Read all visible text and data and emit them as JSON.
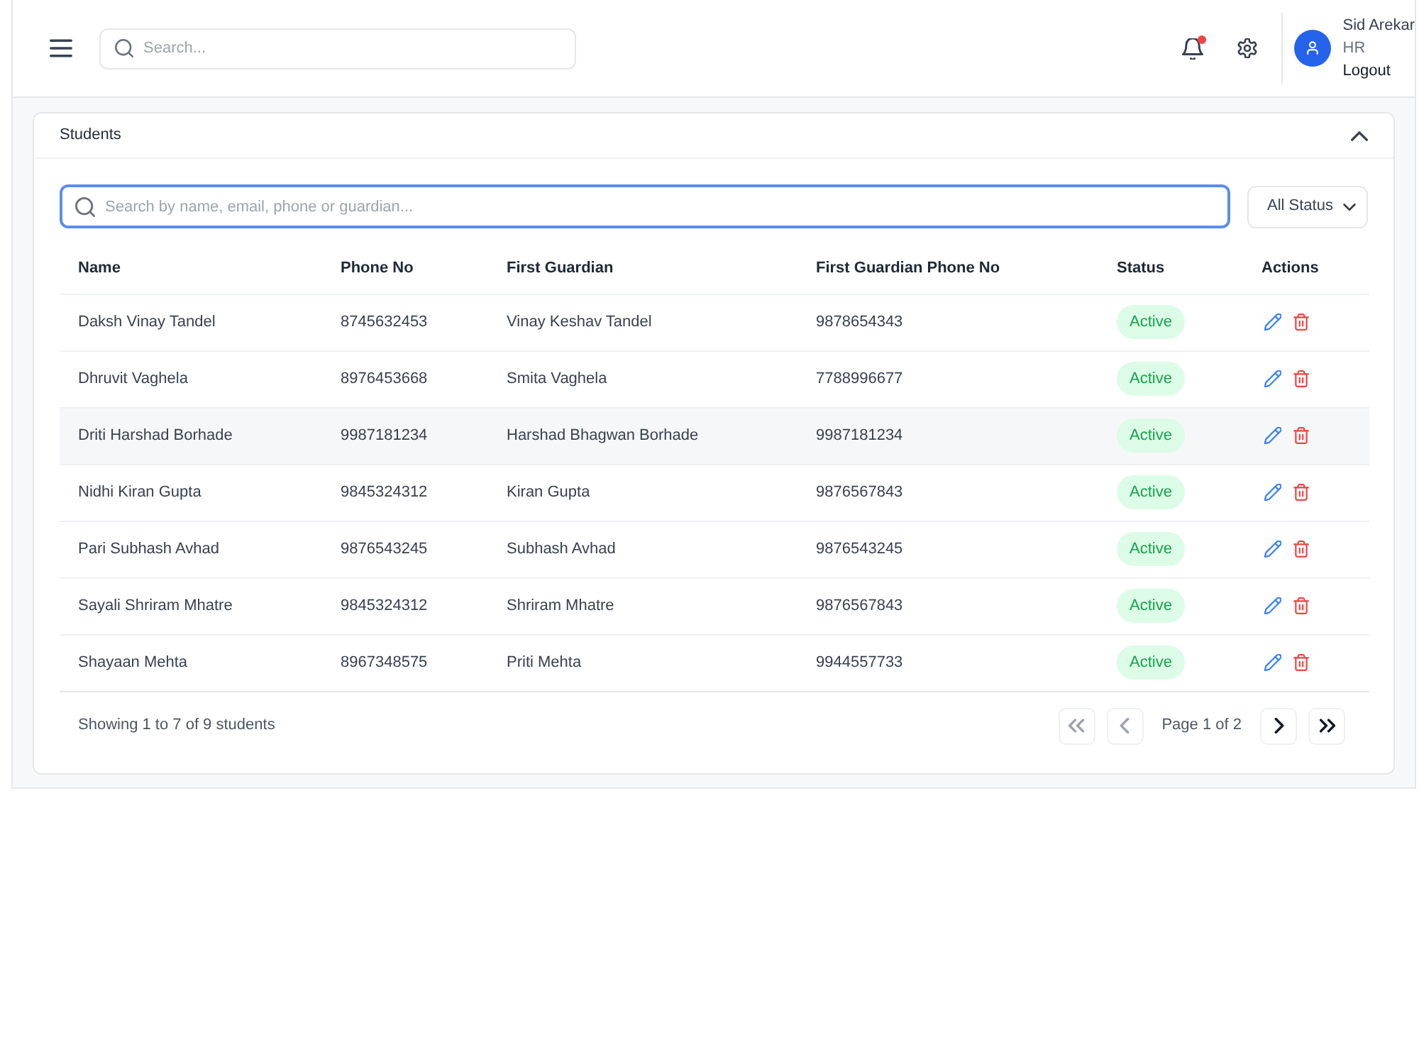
{
  "header": {
    "search": {
      "placeholder": "Search..."
    },
    "notifications": {
      "unread": true
    },
    "user": {
      "name": "Sid Arekar",
      "role": "HR",
      "logout": "Logout"
    }
  },
  "card": {
    "title": "Students",
    "expanded": true,
    "search": {
      "placeholder": "Search by name, email, phone or guardian...",
      "focused": true
    },
    "status_filter": {
      "value": "All Status"
    },
    "table": {
      "columns": [
        "Name",
        "Phone No",
        "First Guardian",
        "First Guardian Phone No",
        "Status",
        "Actions"
      ],
      "rows": [
        {
          "name": "Daksh Vinay Tandel",
          "phone": "8745632453",
          "guardian": "Vinay Keshav Tandel",
          "guardian_phone": "9878654343",
          "status": "Active",
          "highlighted": false
        },
        {
          "name": "Dhruvit Vaghela",
          "phone": "8976453668",
          "guardian": "Smita Vaghela",
          "guardian_phone": "7788996677",
          "status": "Active",
          "highlighted": false
        },
        {
          "name": "Driti Harshad Borhade",
          "phone": "9987181234",
          "guardian": "Harshad Bhagwan Borhade",
          "guardian_phone": "9987181234",
          "status": "Active",
          "highlighted": true
        },
        {
          "name": "Nidhi Kiran Gupta",
          "phone": "9845324312",
          "guardian": "Kiran Gupta",
          "guardian_phone": "9876567843",
          "status": "Active",
          "highlighted": false
        },
        {
          "name": "Pari Subhash Avhad",
          "phone": "9876543245",
          "guardian": "Subhash Avhad",
          "guardian_phone": "9876543245",
          "status": "Active",
          "highlighted": false
        },
        {
          "name": "Sayali Shriram Mhatre",
          "phone": "9845324312",
          "guardian": "Shriram Mhatre",
          "guardian_phone": "9876567843",
          "status": "Active",
          "highlighted": false
        },
        {
          "name": "Shayaan Mehta",
          "phone": "8967348575",
          "guardian": "Priti Mehta",
          "guardian_phone": "9944557733",
          "status": "Active",
          "highlighted": false
        }
      ]
    },
    "footer": {
      "summary": "Showing 1 to 7 of 9 students",
      "pagination": {
        "first": {
          "disabled": true
        },
        "previous": {
          "disabled": true
        },
        "page_label": "Page 1 of 2",
        "next": {
          "disabled": false
        },
        "last": {
          "disabled": false
        }
      }
    }
  }
}
